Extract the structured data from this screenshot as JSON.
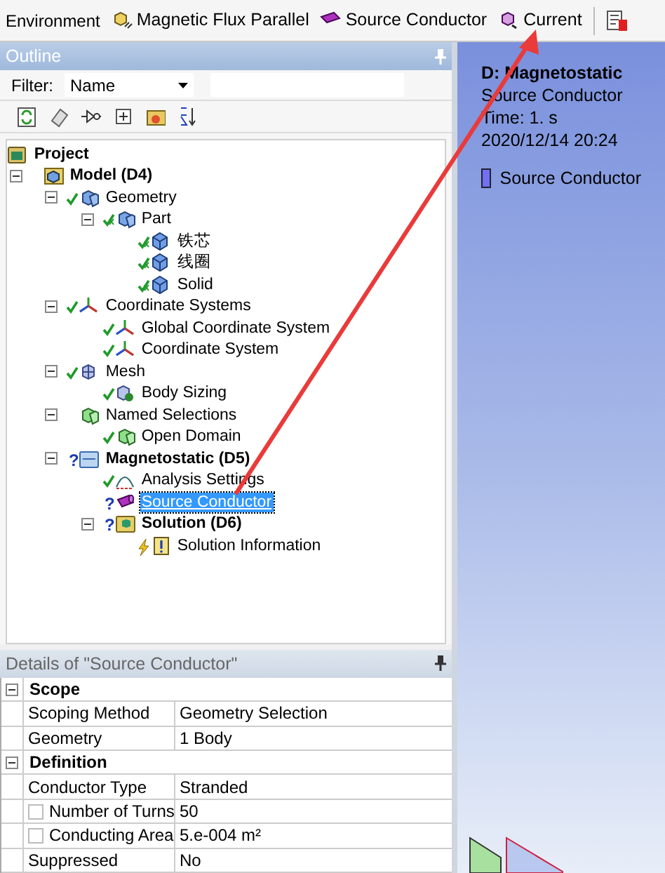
{
  "toolbar": {
    "label": "Environment",
    "items": [
      {
        "kind": "flux",
        "label": "Magnetic Flux Parallel"
      },
      {
        "kind": "conductor",
        "label": "Source Conductor"
      },
      {
        "kind": "current",
        "label": "Current"
      }
    ]
  },
  "outline": {
    "title": "Outline",
    "filter_label": "Filter:",
    "filter_value": "Name",
    "tree": [
      {
        "label": "Project",
        "kind": "project",
        "bold": true,
        "children": [
          {
            "label": "Model (D4)",
            "kind": "model",
            "bold": true,
            "expanded": true,
            "children": [
              {
                "label": "Geometry",
                "kind": "geometry",
                "ok": true,
                "expanded": true,
                "children": [
                  {
                    "label": "Part",
                    "kind": "geometry",
                    "ok": true,
                    "meshed": true,
                    "expanded": true,
                    "children": [
                      {
                        "label": "铁芯",
                        "kind": "body",
                        "ok": true,
                        "meshed": true
                      },
                      {
                        "label": "线圈",
                        "kind": "body",
                        "ok": true,
                        "meshed": true
                      },
                      {
                        "label": "Solid",
                        "kind": "body",
                        "ok": true,
                        "meshed": true
                      }
                    ]
                  }
                ]
              },
              {
                "label": "Coordinate Systems",
                "kind": "axes",
                "ok": true,
                "expanded": true,
                "children": [
                  {
                    "label": "Global Coordinate System",
                    "kind": "axes",
                    "ok": true
                  },
                  {
                    "label": "Coordinate System",
                    "kind": "axes",
                    "ok": true
                  }
                ]
              },
              {
                "label": "Mesh",
                "kind": "mesh",
                "ok": true,
                "expanded": true,
                "children": [
                  {
                    "label": "Body Sizing",
                    "kind": "sizing",
                    "ok": true
                  }
                ]
              },
              {
                "label": "Named Selections",
                "kind": "named",
                "expanded": true,
                "children": [
                  {
                    "label": "Open Domain",
                    "kind": "named",
                    "ok": true
                  }
                ]
              },
              {
                "label": "Magnetostatic (D5)",
                "kind": "analysis",
                "mark": "?",
                "bold": true,
                "expanded": true,
                "children": [
                  {
                    "label": "Analysis Settings",
                    "kind": "settings",
                    "ok": true
                  },
                  {
                    "label": "Source Conductor",
                    "kind": "conductor",
                    "mark": "?",
                    "selected": true
                  },
                  {
                    "label": "Solution (D6)",
                    "kind": "solution",
                    "mark": "?",
                    "bold": true,
                    "expanded": true,
                    "children": [
                      {
                        "label": "Solution Information",
                        "kind": "info",
                        "pending": true
                      }
                    ]
                  }
                ]
              }
            ]
          }
        ]
      }
    ]
  },
  "details": {
    "title": "Details of \"Source Conductor\"",
    "sections": [
      {
        "title": "Scope",
        "expanded": true,
        "rows": [
          {
            "label": "Scoping Method",
            "value": "Geometry Selection"
          },
          {
            "label": "Geometry",
            "value": "1 Body"
          }
        ]
      },
      {
        "title": "Definition",
        "expanded": true,
        "rows": [
          {
            "label": "Conductor Type",
            "value": "Stranded"
          },
          {
            "label": "Number of Turns",
            "value": "50",
            "checked": false
          },
          {
            "label": "Conducting Area",
            "value": "5.e-004 m²",
            "checked": false
          },
          {
            "label": "Suppressed",
            "value": "No"
          }
        ]
      }
    ]
  },
  "viewport": {
    "title": "D: Magnetostatic",
    "lines": [
      "Source Conductor",
      "Time: 1. s",
      "2020/12/14 20:24"
    ],
    "legend": [
      {
        "label": "Source Conductor",
        "color": "#7070f0"
      }
    ]
  }
}
